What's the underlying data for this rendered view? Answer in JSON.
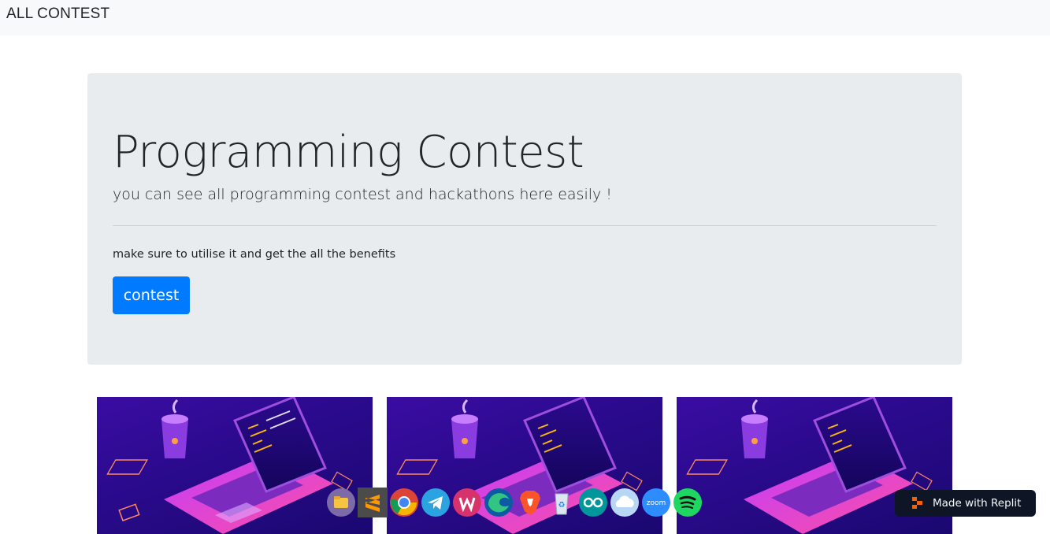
{
  "navbar": {
    "brand": "ALL CONTEST"
  },
  "jumbotron": {
    "title": "Programming Contest",
    "lead": "you can see all programming contest and hackathons here easily !",
    "text": "make sure to utilise it and get the all the benefits",
    "button_label": "contest"
  },
  "cards": [
    {
      "image": "laptop-coffee-illustration"
    },
    {
      "image": "laptop-coffee-illustration"
    },
    {
      "image": "laptop-coffee-illustration"
    }
  ],
  "taskbar": {
    "icons": [
      "file-manager-icon",
      "sublime-text-icon",
      "chrome-icon",
      "telegram-icon",
      "wps-office-icon",
      "edge-icon",
      "brave-icon",
      "recycle-bin-icon",
      "arduino-icon",
      "icloud-icon",
      "zoom-icon",
      "spotify-icon"
    ],
    "zoom_label": "zoom"
  },
  "replit_badge": {
    "label": "Made with Replit"
  },
  "colors": {
    "primary": "#007bff",
    "jumbotron_bg": "#e9ecef",
    "navbar_bg": "#f8f9fa",
    "replit_bg": "#0e1525"
  }
}
